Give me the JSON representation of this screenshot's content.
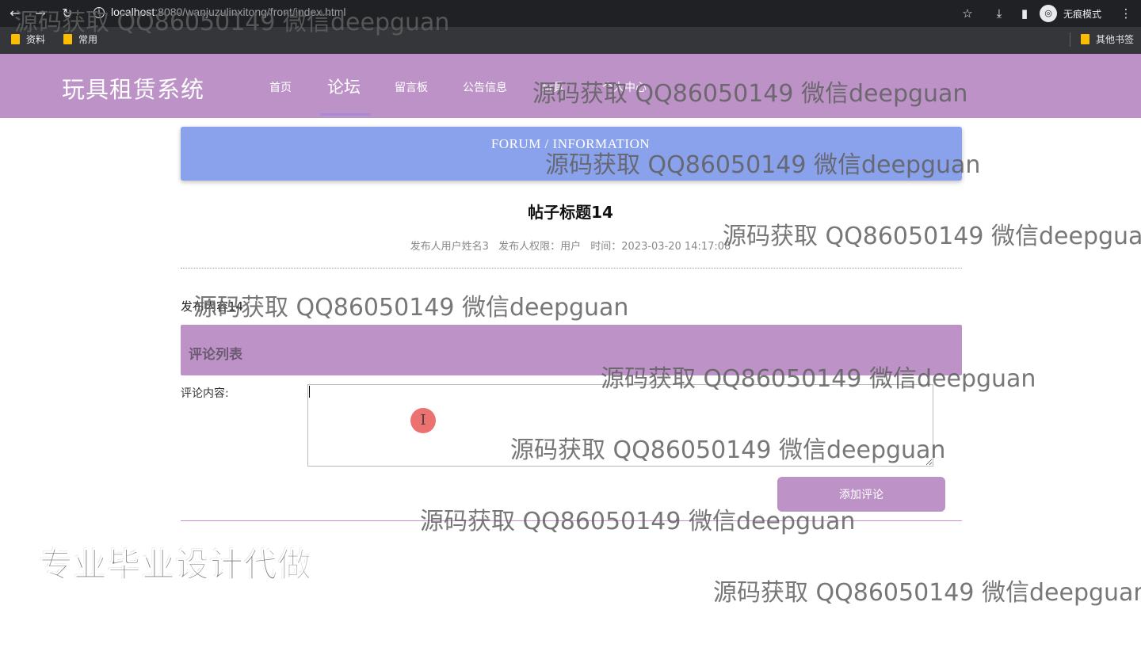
{
  "browser": {
    "url_host": "localhost",
    "url_path": ":8080/wanjuzulinxitong/front/index.html",
    "incognito_label": "无痕模式",
    "bookmarks": [
      "资料",
      "常用"
    ],
    "other_bookmarks": "其他书签"
  },
  "site": {
    "logo": "玩具租赁系统",
    "nav": [
      {
        "label": "首页",
        "active": false
      },
      {
        "label": "论坛",
        "active": true
      },
      {
        "label": "留言板",
        "active": false
      },
      {
        "label": "公告信息",
        "active": false
      },
      {
        "label": "玩具",
        "active": false
      },
      {
        "label": "个人中心",
        "active": false
      }
    ]
  },
  "banner": {
    "text": "FORUM / INFORMATION"
  },
  "post": {
    "title": "帖子标题14",
    "author": "发布人用户姓名3",
    "role": "发布人权限：用户",
    "time": "时间：2023-03-20 14:17:08",
    "content": "发布内容14"
  },
  "comments": {
    "title": "评论列表",
    "input_label": "评论内容:",
    "input_value": "",
    "submit_label": "添加评论"
  },
  "overlay": {
    "watermark": "源码获取 QQ86050149 微信deepguan",
    "promo": "专业毕业设计代做",
    "cursor_glyph": "I"
  },
  "colors": {
    "header": "#bd93c7",
    "banner": "#8aa2eb",
    "button": "#bd93c7"
  }
}
